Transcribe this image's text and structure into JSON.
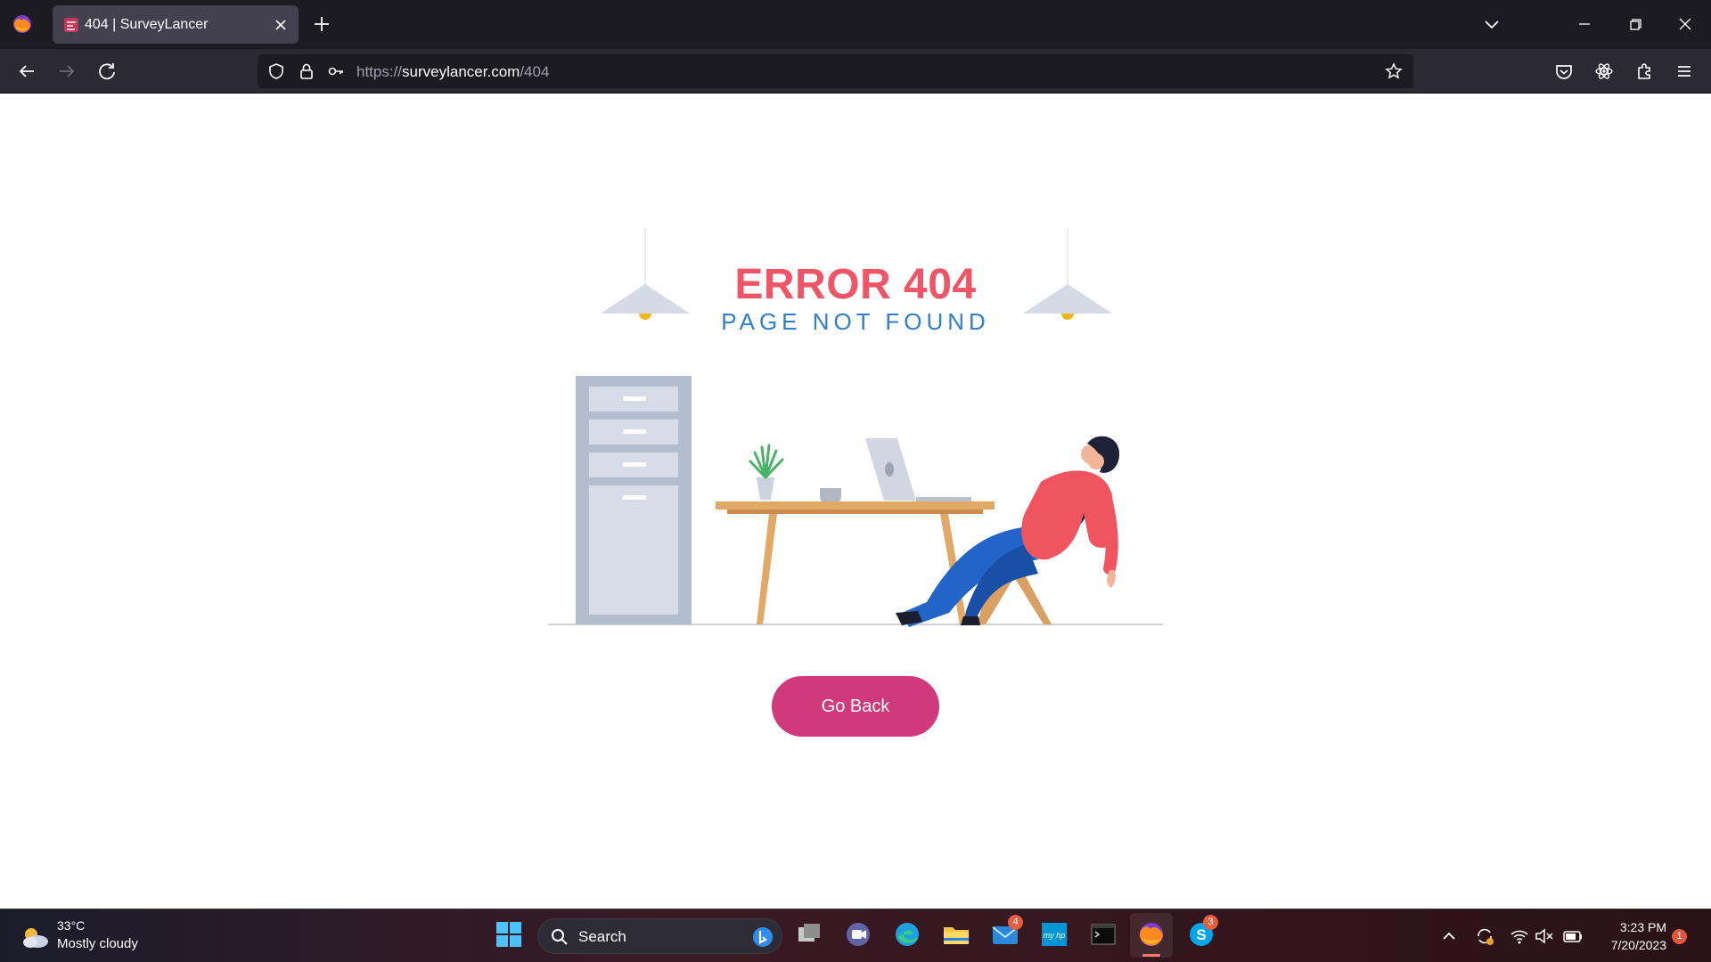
{
  "browser": {
    "tab_title": "404 | SurveyLancer",
    "url_scheme": "https://",
    "url_host": "surveylancer.com",
    "url_path": "/404"
  },
  "page": {
    "error_title": "ERROR 404",
    "error_subtitle": "PAGE NOT FOUND",
    "go_back_label": "Go Back"
  },
  "taskbar": {
    "temperature": "33°C",
    "weather": "Mostly cloudy",
    "search_label": "Search",
    "mail_badge": "4",
    "skype_badge": "3",
    "time": "3:23 PM",
    "date": "7/20/2023",
    "notification_count": "1"
  },
  "colors": {
    "error_title": "#ef5566",
    "subtitle": "#2f7fd1",
    "button": "#d0397b"
  }
}
